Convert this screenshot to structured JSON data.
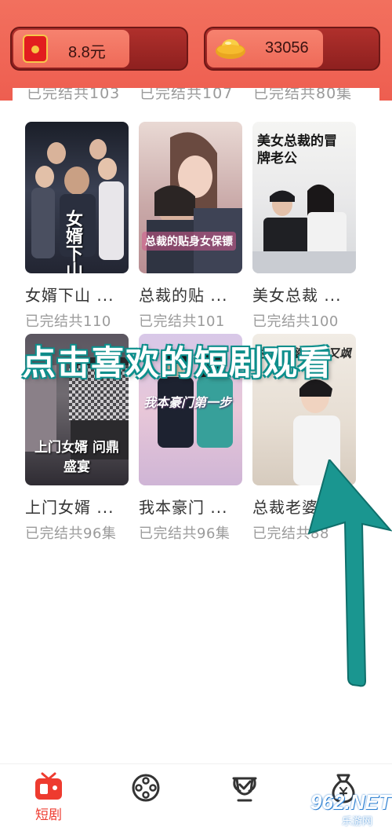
{
  "header": {
    "cash_value": "8.8元",
    "coin_value": "33056",
    "colors": {
      "bg": "#ee5e50",
      "pill": "#9b2824"
    },
    "icons": [
      "red-envelope-icon",
      "gold-ingot-icon"
    ]
  },
  "partial_row": [
    "已完结共103",
    "已完结共107",
    "已完结共80集"
  ],
  "dramas": [
    {
      "title": "女婿下山 ...",
      "subtitle": "已完结共110",
      "poster_text": "女婿下山"
    },
    {
      "title": "总裁的贴 ...",
      "subtitle": "已完结共101",
      "poster_text": "总裁的贴身女保镖"
    },
    {
      "title": "美女总裁 ...",
      "subtitle": "已完结共100",
      "poster_text": "美女总裁的冒牌老公"
    },
    {
      "title": "上门女婿 ...",
      "subtitle": "已完结共96集",
      "poster_text": "上门女婿 问鼎盛宴"
    },
    {
      "title": "我本豪门 ...",
      "subtitle": "已完结共96集",
      "poster_text": "我本豪门第一步"
    },
    {
      "title": "总裁老婆 ...",
      "subtitle": "已完结共88",
      "poster_text": "总裁老婆又美又飒"
    }
  ],
  "annotation": "点击喜欢的短剧观看",
  "nav": {
    "items": [
      {
        "label": "短剧",
        "icon": "tv-icon",
        "active": true
      },
      {
        "label": "",
        "icon": "film-reel-icon",
        "active": false
      },
      {
        "label": "",
        "icon": "trophy-icon",
        "active": false
      },
      {
        "label": "",
        "icon": "money-bag-icon",
        "active": false
      }
    ],
    "active_color": "#ee3b2f"
  },
  "watermark": {
    "main": "962.NET",
    "sub": "乐游网"
  }
}
